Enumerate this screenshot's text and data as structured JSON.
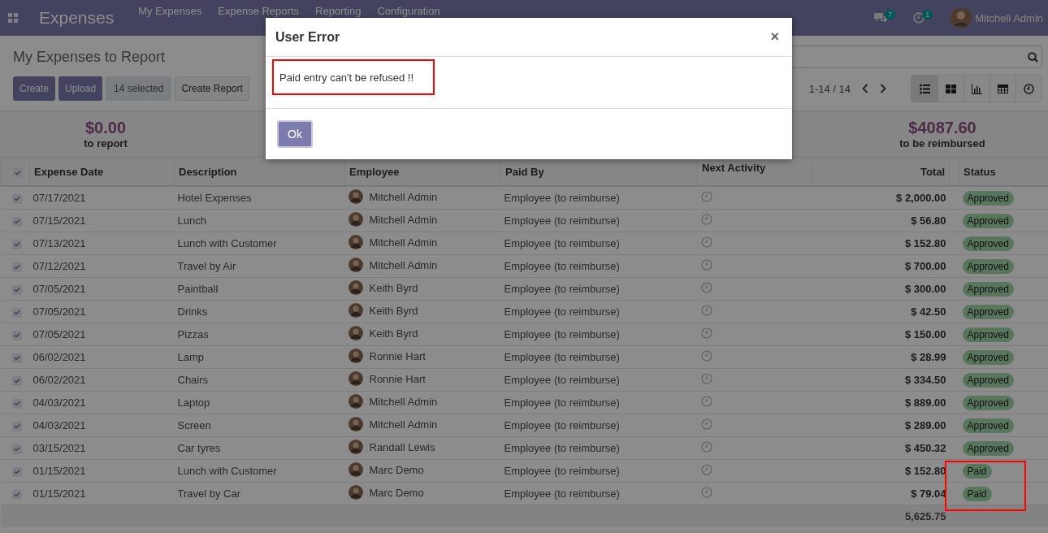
{
  "navbar": {
    "app_title": "Expenses",
    "menu": [
      "My Expenses",
      "Expense Reports",
      "Reporting",
      "Configuration"
    ],
    "messages_count": "7",
    "activities_count": "1",
    "user": "Mitchell Admin"
  },
  "control_panel": {
    "breadcrumb": "My Expenses to Report",
    "buttons": [
      "Create",
      "Upload"
    ],
    "selection": "14 selected",
    "action_button": "Create Report",
    "pager": "1-14 / 14",
    "views": [
      {
        "kind": "list",
        "selected": true
      },
      {
        "kind": "kanban",
        "selected": false
      },
      {
        "kind": "graph",
        "selected": false
      },
      {
        "kind": "pivot",
        "selected": false
      },
      {
        "kind": "activity",
        "selected": false
      }
    ]
  },
  "summary": [
    {
      "amount": "$0.00",
      "label": "to report"
    },
    {
      "amount": "$4087.60",
      "label": "to be reimbursed"
    }
  ],
  "table": {
    "select_all": true,
    "columns": [
      "Expense Date",
      "Description",
      "Employee",
      "Paid By",
      "Next Activity",
      "Total",
      "Status"
    ],
    "rows": [
      {
        "date": "07/17/2021",
        "description": "Hotel Expenses",
        "employee": "Mitchell Admin",
        "paid_by": "Employee (to reimburse)",
        "total": "$ 2,000.00",
        "status": "Approved",
        "selected": true,
        "highlighted": false
      },
      {
        "date": "07/15/2021",
        "description": "Lunch",
        "employee": "Mitchell Admin",
        "paid_by": "Employee (to reimburse)",
        "total": "$ 56.80",
        "status": "Approved",
        "selected": true,
        "highlighted": false
      },
      {
        "date": "07/13/2021",
        "description": "Lunch with Customer",
        "employee": "Mitchell Admin",
        "paid_by": "Employee (to reimburse)",
        "total": "$ 152.80",
        "status": "Approved",
        "selected": true,
        "highlighted": false
      },
      {
        "date": "07/12/2021",
        "description": "Travel by Air",
        "employee": "Mitchell Admin",
        "paid_by": "Employee (to reimburse)",
        "total": "$ 700.00",
        "status": "Approved",
        "selected": true,
        "highlighted": false
      },
      {
        "date": "07/05/2021",
        "description": "Paintball",
        "employee": "Keith Byrd",
        "paid_by": "Employee (to reimburse)",
        "total": "$ 300.00",
        "status": "Approved",
        "selected": true,
        "highlighted": false
      },
      {
        "date": "07/05/2021",
        "description": "Drinks",
        "employee": "Keith Byrd",
        "paid_by": "Employee (to reimburse)",
        "total": "$ 42.50",
        "status": "Approved",
        "selected": true,
        "highlighted": false
      },
      {
        "date": "07/05/2021",
        "description": "Pizzas",
        "employee": "Keith Byrd",
        "paid_by": "Employee (to reimburse)",
        "total": "$ 150.00",
        "status": "Approved",
        "selected": true,
        "highlighted": false
      },
      {
        "date": "06/02/2021",
        "description": "Lamp",
        "employee": "Ronnie Hart",
        "paid_by": "Employee (to reimburse)",
        "total": "$ 28.99",
        "status": "Approved",
        "selected": true,
        "highlighted": false
      },
      {
        "date": "06/02/2021",
        "description": "Chairs",
        "employee": "Ronnie Hart",
        "paid_by": "Employee (to reimburse)",
        "total": "$ 334.50",
        "status": "Approved",
        "selected": true,
        "highlighted": false
      },
      {
        "date": "04/03/2021",
        "description": "Laptop",
        "employee": "Mitchell Admin",
        "paid_by": "Employee (to reimburse)",
        "total": "$ 889.00",
        "status": "Approved",
        "selected": true,
        "highlighted": false
      },
      {
        "date": "04/03/2021",
        "description": "Screen",
        "employee": "Mitchell Admin",
        "paid_by": "Employee (to reimburse)",
        "total": "$ 289.00",
        "status": "Approved",
        "selected": true,
        "highlighted": false
      },
      {
        "date": "03/15/2021",
        "description": "Car tyres",
        "employee": "Randall Lewis",
        "paid_by": "Employee (to reimburse)",
        "total": "$ 450.32",
        "status": "Approved",
        "selected": true,
        "highlighted": false
      },
      {
        "date": "01/15/2021",
        "description": "Lunch with Customer",
        "employee": "Marc Demo",
        "paid_by": "Employee (to reimburse)",
        "total": "$ 152.80",
        "status": "Paid",
        "selected": true,
        "highlighted": true
      },
      {
        "date": "01/15/2021",
        "description": "Travel by Car",
        "employee": "Marc Demo",
        "paid_by": "Employee (to reimburse)",
        "total": "$ 79.04",
        "status": "Paid",
        "selected": true,
        "highlighted": true
      }
    ],
    "footer_total": "5,625.75"
  },
  "dialog": {
    "title": "User Error",
    "close": "×",
    "message": "Paid entry can't be refused !!",
    "message_highlighted": true,
    "button": "Ok"
  }
}
